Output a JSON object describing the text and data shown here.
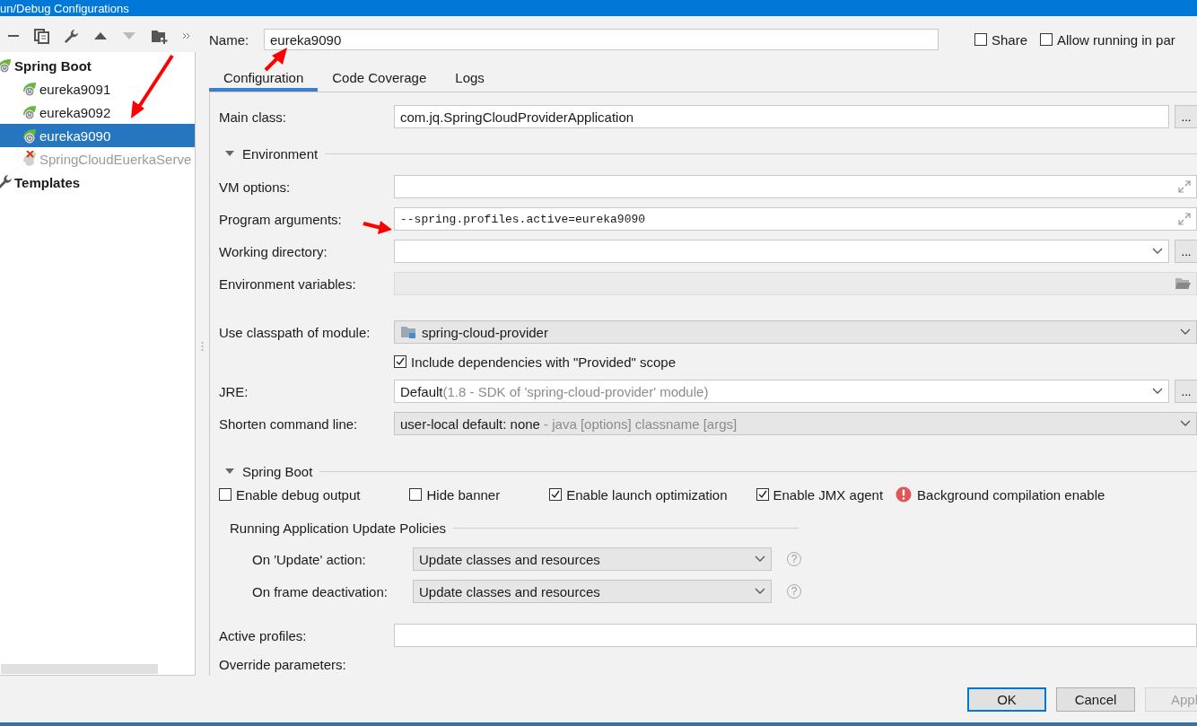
{
  "window": {
    "title": "un/Debug Configurations"
  },
  "tree": [
    {
      "label": "Spring Boot",
      "kind": "spring_boot",
      "children": [
        {
          "label": "eureka9091",
          "selected": false,
          "error": false
        },
        {
          "label": "eureka9092",
          "selected": false,
          "error": false
        },
        {
          "label": "eureka9090",
          "selected": true,
          "error": false
        },
        {
          "label": "SpringCloudEuerkaServe",
          "selected": false,
          "error": true
        }
      ]
    },
    {
      "label": "Templates",
      "kind": "templates"
    }
  ],
  "name_field": {
    "label": "Name:",
    "value": "eureka9090"
  },
  "header_options": [
    {
      "label": "Share",
      "checked": false
    },
    {
      "label": "Allow running in par",
      "checked": false
    }
  ],
  "tabs": [
    {
      "label": "Configuration",
      "selected": true
    },
    {
      "label": "Code Coverage",
      "selected": false
    },
    {
      "label": "Logs",
      "selected": false
    }
  ],
  "main_class": {
    "label": "Main class:",
    "kind": "text",
    "value": "com.jq.SpringCloudProviderApplication",
    "browse": "..."
  },
  "environment": {
    "title": "Environment",
    "expanded": true,
    "fields": [
      {
        "label": "VM options:",
        "kind": "expand"
      },
      {
        "label": "Program arguments:",
        "kind": "args",
        "value": "--spring.profiles.active=eureka9090"
      },
      {
        "label": "Working directory:",
        "kind": "combo",
        "browse": "..."
      },
      {
        "label": "Environment variables:",
        "kind": "readonly"
      }
    ]
  },
  "classpath": [
    {
      "label": "Use classpath of module:",
      "kind": "module_combo",
      "value": "spring-cloud-provider"
    },
    {
      "label": "Include dependencies with \"Provided\" scope",
      "kind": "checkbox",
      "checked": true
    },
    {
      "label": "JRE:",
      "kind": "combo",
      "value": "Default",
      "hint": "(1.8 - SDK of 'spring-cloud-provider' module)",
      "browse": "..."
    },
    {
      "label": "Shorten command line:",
      "kind": "gray_combo",
      "value": "user-local default: none",
      "hint": " - java [options] classname [args]"
    }
  ],
  "spring_boot": {
    "title": "Spring Boot",
    "expanded": true,
    "options": [
      {
        "label": "Enable debug output",
        "checked": false
      },
      {
        "label": "Hide banner",
        "checked": false
      },
      {
        "label": "Enable launch optimization",
        "checked": true
      },
      {
        "label": "Enable JMX agent",
        "checked": true
      }
    ],
    "warning": "Background compilation enable",
    "update_policies": {
      "title": "Running Application Update Policies",
      "rows": [
        {
          "label": "On 'Update' action:",
          "value": "Update classes and resources",
          "help": "?"
        },
        {
          "label": "On frame deactivation:",
          "value": "Update classes and resources",
          "help": "?"
        }
      ]
    },
    "active_profiles": {
      "label": "Active profiles:"
    },
    "override_parameters": {
      "label": "Override parameters:"
    }
  },
  "buttons": [
    {
      "label": "OK",
      "kind": "default"
    },
    {
      "label": "Cancel",
      "kind": "normal"
    },
    {
      "label": "Appl",
      "kind": "disabled"
    }
  ]
}
